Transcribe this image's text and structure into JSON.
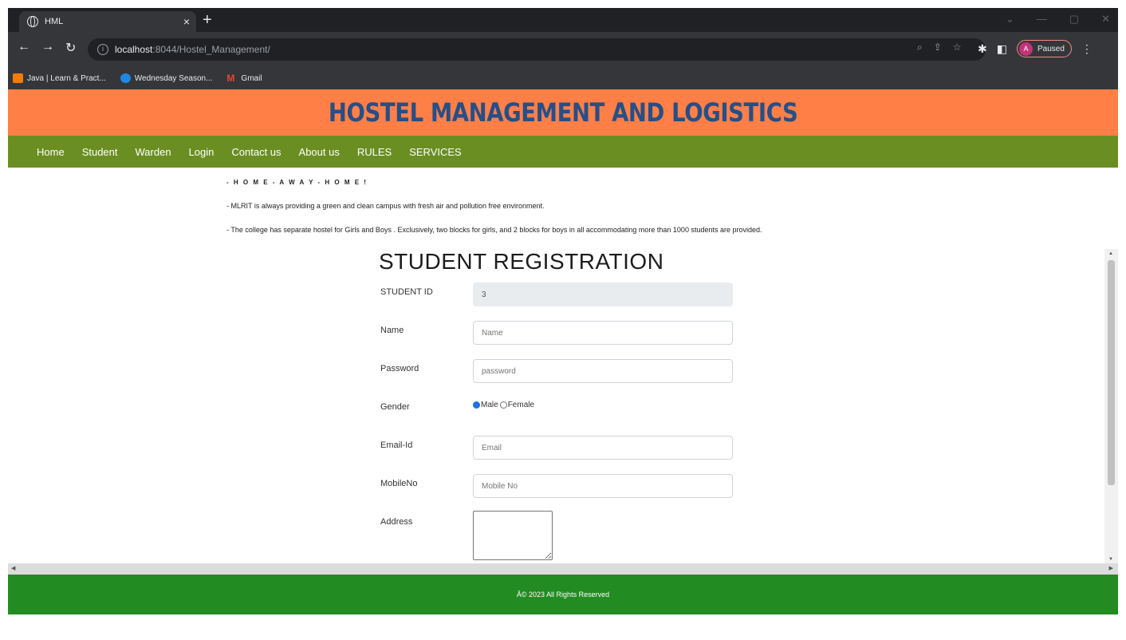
{
  "browser": {
    "tab_title": "HML",
    "tab_close": "×",
    "new_tab": "+",
    "url_host": "localhost",
    "url_rest": ":8044/Hostel_Management/",
    "profile_initial": "A",
    "profile_status": "Paused",
    "bookmarks": [
      {
        "label": "Java | Learn & Pract...",
        "color": "#f57c00"
      },
      {
        "label": "Wednesday Season...",
        "color": "#1e88e5"
      },
      {
        "label": "Gmail",
        "color": "#ea4335"
      }
    ]
  },
  "header": {
    "title": "HOSTEL MANAGEMENT AND LOGISTICS",
    "banner_color": "#ff7f47",
    "title_color": "#264f87"
  },
  "nav": {
    "color": "#6b8e23",
    "items": [
      "Home",
      "Student",
      "Warden",
      "Login",
      "Contact us",
      "About us",
      "RULES",
      "SERVICES"
    ]
  },
  "intro": {
    "tagline": "- H O M E - A W A Y - H O M E !",
    "line1": "- MLRIT is always providing a green and clean campus with fresh air and pollution free environment.",
    "line2": "- The college has separate hostel for Girls and Boys . Exclusively, two blocks for girls, and 2 blocks for boys in all accommodating more than 1000 students are provided."
  },
  "form": {
    "title": "STUDENT REGISTRATION",
    "student_id_label": "STUDENT ID",
    "student_id_value": "3",
    "name_label": "Name",
    "name_placeholder": "Name",
    "password_label": "Password",
    "password_placeholder": "password",
    "gender_label": "Gender",
    "gender_male": "Male",
    "gender_female": "Female",
    "gender_selected": "Male",
    "email_label": "Email-Id",
    "email_placeholder": "Email",
    "mobile_label": "MobileNo",
    "mobile_placeholder": "Mobile No",
    "address_label": "Address"
  },
  "footer": {
    "text": "Â© 2023 All Rights Reserved",
    "color": "#228b22"
  }
}
